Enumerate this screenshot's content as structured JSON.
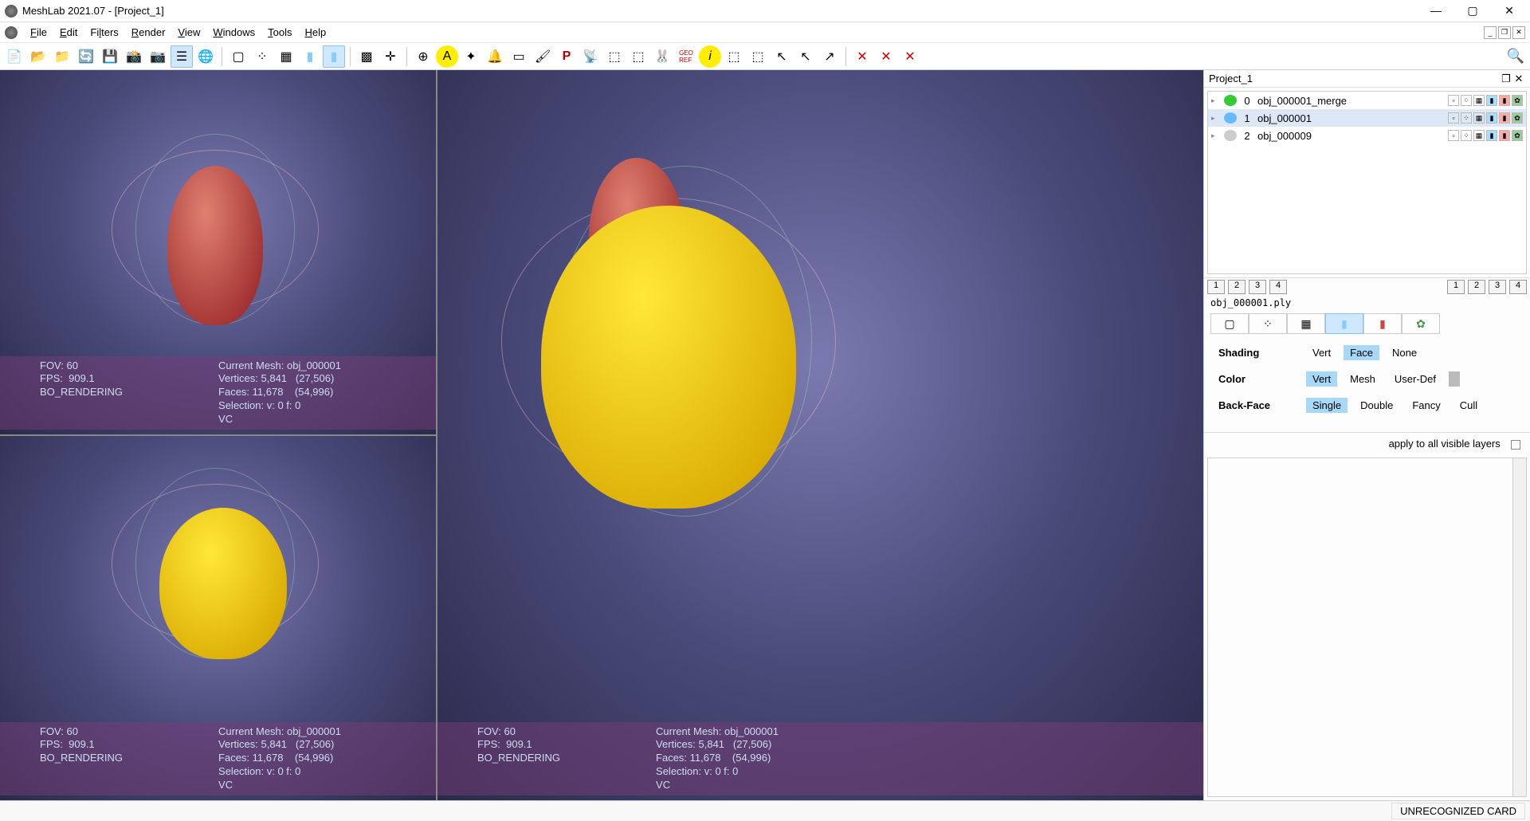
{
  "window": {
    "title": "MeshLab 2021.07 - [Project_1]"
  },
  "menu": [
    "File",
    "Edit",
    "Filters",
    "Render",
    "View",
    "Windows",
    "Tools",
    "Help"
  ],
  "project_panel_title": "Project_1",
  "layers": [
    {
      "idx": "0",
      "name": "obj_000001_merge",
      "sel": false,
      "eye": "#3c3"
    },
    {
      "idx": "1",
      "name": "obj_000001",
      "sel": true,
      "eye": "#6bf"
    },
    {
      "idx": "2",
      "name": "obj_000009",
      "sel": false,
      "eye": "#ccc"
    }
  ],
  "view_buttons_left": [
    "1",
    "2",
    "3",
    "4"
  ],
  "view_buttons_right": [
    "1",
    "2",
    "3",
    "4"
  ],
  "prop_filename": "obj_000001.ply",
  "props": {
    "shading": {
      "label": "Shading",
      "opts": [
        "Vert",
        "Face",
        "None"
      ],
      "sel": "Face"
    },
    "color": {
      "label": "Color",
      "opts": [
        "Vert",
        "Mesh",
        "User-Def"
      ],
      "sel": "Vert",
      "swatch": true
    },
    "backface": {
      "label": "Back-Face",
      "opts": [
        "Single",
        "Double",
        "Fancy",
        "Cull"
      ],
      "sel": "Single"
    }
  },
  "apply_label": "apply to all visible layers",
  "viewport_info": {
    "left": "FOV: 60\nFPS:  909.1\nBO_RENDERING",
    "right": "Current Mesh: obj_000001\nVertices: 5,841   (27,506)\nFaces: 11,678    (54,996)\nSelection: v: 0 f: 0\nVC"
  },
  "status": {
    "card": "UNRECOGNIZED CARD"
  }
}
